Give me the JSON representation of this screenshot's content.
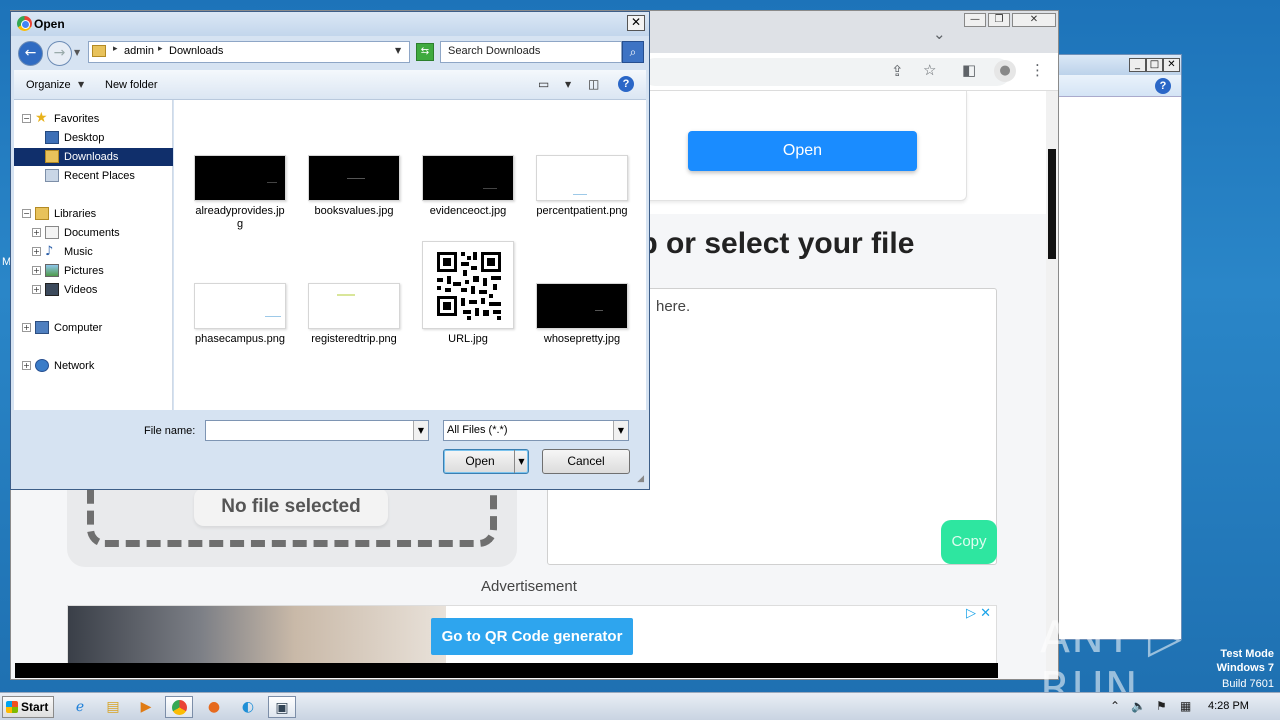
{
  "desktop": {
    "stray_text": "M"
  },
  "bg_window": {
    "minimize": "_",
    "maximize": "□",
    "close": "✕",
    "help": "?"
  },
  "browser": {
    "window_controls": {
      "minimize": "—",
      "maximize": "❐",
      "close": "✕"
    },
    "tab_dropdown": "⌄",
    "toolbar_icons": {
      "share": "⇪",
      "bookmark": "☆",
      "side_panel": "◧",
      "profile": "●",
      "menu": "⋮"
    },
    "page": {
      "open_button": "Open",
      "heading": "op or select your file",
      "textarea_text": "here.",
      "copy_button": "Copy",
      "no_file": "No file selected",
      "ad_label": "Advertisement",
      "ad_button": "Go to QR Code generator",
      "ad_icons": "▷ ✕"
    }
  },
  "dialog": {
    "title": "Open",
    "close": "✕",
    "back": "←",
    "forward": "→",
    "path": [
      "admin",
      "Downloads"
    ],
    "search_placeholder": "Search Downloads",
    "commands": {
      "organize": "Organize",
      "new_folder": "New folder"
    },
    "tree": [
      {
        "label": "Favorites",
        "level": 0,
        "expander": "−",
        "icon": "star-icon"
      },
      {
        "label": "Desktop",
        "level": 1,
        "icon": "desktop-icon"
      },
      {
        "label": "Downloads",
        "level": 1,
        "icon": "downloads-folder-icon",
        "selected": true
      },
      {
        "label": "Recent Places",
        "level": 1,
        "icon": "recent-places-icon"
      },
      {
        "label": "Libraries",
        "level": 0,
        "expander": "−",
        "icon": "libraries-icon"
      },
      {
        "label": "Documents",
        "level": 1,
        "expander": "+",
        "icon": "documents-icon"
      },
      {
        "label": "Music",
        "level": 1,
        "expander": "+",
        "icon": "music-icon"
      },
      {
        "label": "Pictures",
        "level": 1,
        "expander": "+",
        "icon": "pictures-icon"
      },
      {
        "label": "Videos",
        "level": 1,
        "expander": "+",
        "icon": "videos-icon"
      },
      {
        "label": "Computer",
        "level": 0,
        "expander": "+",
        "icon": "computer-icon"
      },
      {
        "label": "Network",
        "level": 0,
        "expander": "+",
        "icon": "network-icon"
      }
    ],
    "files": [
      {
        "name": "alreadyprovides.jpg",
        "thumb": "dark"
      },
      {
        "name": "booksvalues.jpg",
        "thumb": "dark"
      },
      {
        "name": "evidenceoct.jpg",
        "thumb": "dark"
      },
      {
        "name": "percentpatient.png",
        "thumb": "light"
      },
      {
        "name": "phasecampus.png",
        "thumb": "light"
      },
      {
        "name": "registeredtrip.png",
        "thumb": "light"
      },
      {
        "name": "URL.jpg",
        "thumb": "qr"
      },
      {
        "name": "whosepretty.jpg",
        "thumb": "dark"
      }
    ],
    "file_name_label": "File name:",
    "file_name_value": "",
    "filter": "All Files (*.*)",
    "open_button": "Open",
    "cancel_button": "Cancel"
  },
  "watermark": {
    "brand": "ANY ▷ RUN",
    "test_mode": "Test Mode",
    "os": "Windows 7",
    "build": "Build 7601"
  },
  "taskbar": {
    "start": "Start",
    "apps": [
      "ie-icon",
      "explorer-icon",
      "media-player-icon",
      "chrome-icon",
      "firefox-icon",
      "edge-icon",
      "task-manager-icon"
    ],
    "clock": "4:28 PM"
  }
}
